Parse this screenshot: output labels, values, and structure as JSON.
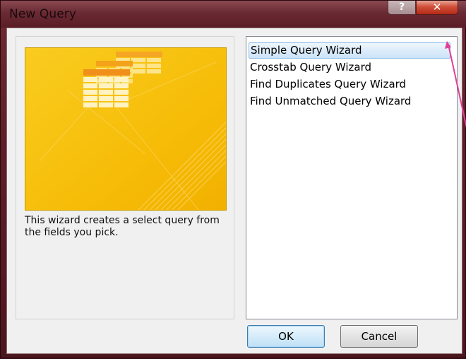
{
  "window": {
    "title": "New Query",
    "help_glyph": "?",
    "close_glyph": "✕"
  },
  "description": "This wizard creates a select query from the fields you pick.",
  "wizards": [
    {
      "label": "Simple Query Wizard",
      "selected": true
    },
    {
      "label": "Crosstab Query Wizard",
      "selected": false
    },
    {
      "label": "Find Duplicates Query Wizard",
      "selected": false
    },
    {
      "label": "Find Unmatched Query Wizard",
      "selected": false
    }
  ],
  "buttons": {
    "ok_label": "OK",
    "cancel_label": "Cancel"
  },
  "colors": {
    "preview_yellow": "#f7c20e",
    "selection_blue": "#cbe3f8",
    "annotation_pink": "#e0409a"
  }
}
